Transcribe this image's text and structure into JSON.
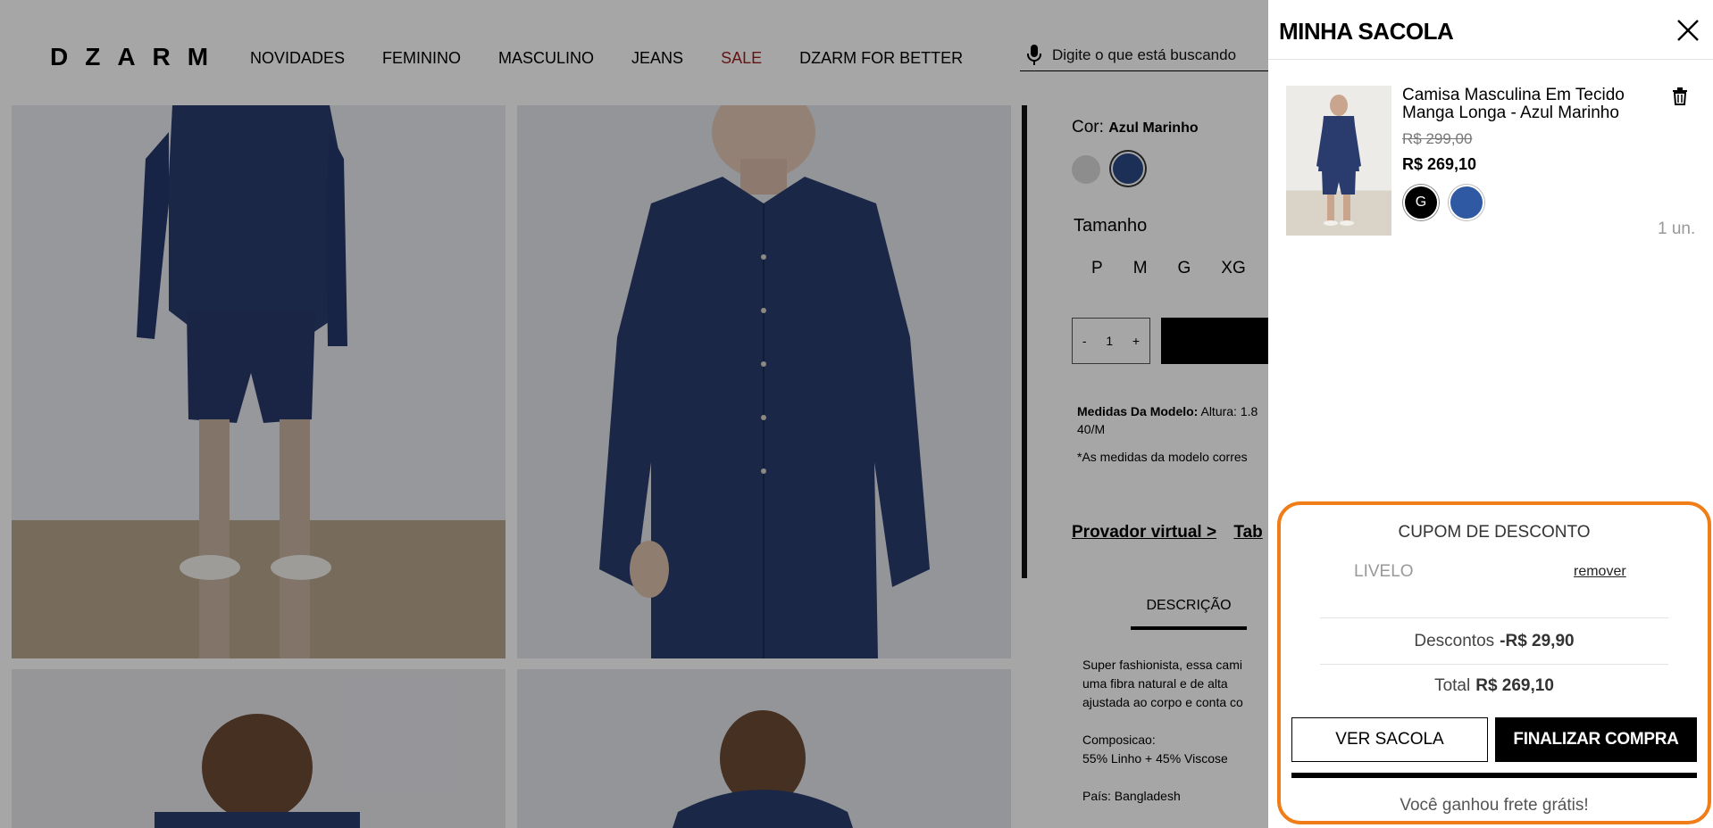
{
  "header": {
    "logo": "DZARM",
    "nav": [
      "NOVIDADES",
      "FEMININO",
      "MASCULINO",
      "JEANS",
      "SALE",
      "DZARM FOR BETTER"
    ],
    "search_placeholder": "Digite o que está buscando"
  },
  "product": {
    "color_label": "Cor:",
    "color_value": "Azul Marinho",
    "size_label": "Tamanho",
    "sizes": [
      "P",
      "M",
      "G",
      "XG"
    ],
    "qty": {
      "minus": "-",
      "value": "1",
      "plus": "+"
    },
    "model_label": "Medidas Da Modelo:",
    "model_value": " Altura: 1.8",
    "model_value_2": "40/M",
    "model_note": "*As medidas da modelo corres",
    "links": [
      "Provador virtual >",
      "Tab"
    ],
    "tab_description": "DESCRIÇÃO",
    "description_lines": [
      "Super fashionista, essa cami",
      "uma fibra natural e de alta",
      "ajustada ao corpo e conta co"
    ],
    "composition_label": "Composicao:",
    "composition_value": "55% Linho + 45% Viscose",
    "country": "País: Bangladesh",
    "colors": {
      "navy": "#2c4a86",
      "gray": "#d9d9d9"
    }
  },
  "cart": {
    "title": "MINHA SACOLA",
    "item": {
      "name": "Camisa Masculina Em Tecido Manga Longa - Azul Marinho",
      "old_price": "R$ 299,00",
      "price": "R$ 269,10",
      "size": "G",
      "color": "#2f5aa3",
      "qty": "1 un."
    },
    "coupon_title": "CUPOM DE DESCONTO",
    "coupon_code": "LIVELO",
    "remove": "remover",
    "discount_label": "Descontos",
    "discount_value": "-R$ 29,90",
    "total_label": "Total",
    "total_value": "R$ 269,10",
    "view_bag": "VER SACOLA",
    "checkout": "FINALIZAR COMPRA",
    "free_shipping": "Você ganhou frete grátis!",
    "free_shipping_progress": 1.0,
    "highlight_color": "#f07d17"
  }
}
